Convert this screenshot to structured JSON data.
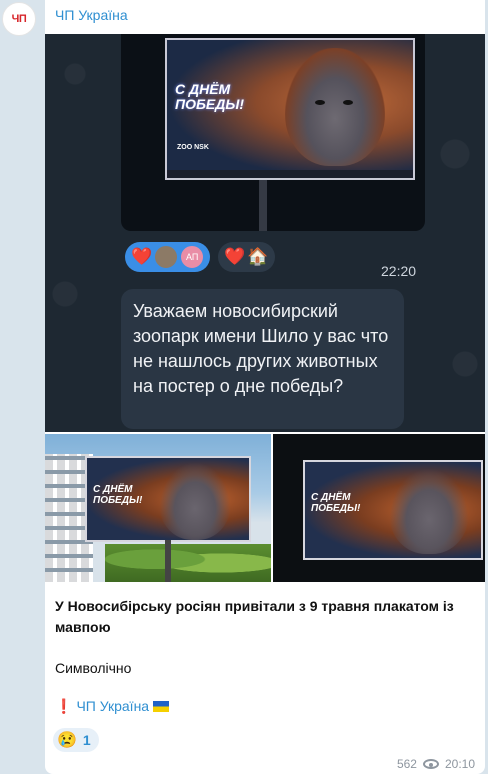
{
  "channel": {
    "avatar_text": "ЧП",
    "name": "ЧП Україна"
  },
  "screenshot": {
    "billboard_text": "С ДНЁМ ПОБЕДЫ!",
    "billboard_logo": "ZOO NSK",
    "reactions": [
      "❤️",
      "❤️",
      "🏠"
    ],
    "reaction_avatar_text": "АП",
    "time": "22:20",
    "message": "Уважаем новосибирский зоопарк имени Шило у вас что не нашлось других животных на постер о дне победы?"
  },
  "photos": {
    "left_billboard_text": "С ДНЁМ ПОБЕДЫ!",
    "right_billboard_text": "С ДНЁМ ПОБЕДЫ!"
  },
  "post": {
    "title": "У Новосибірську росіян привітали з 9 травня плакатом із мавпою",
    "body": "Символічно",
    "signature_mark": "❗",
    "signature": "ЧП Україна",
    "reaction_emoji": "😢",
    "reaction_count": "1",
    "views": "562",
    "time": "20:10"
  },
  "colors": {
    "accent": "#2f8fd1",
    "brand_red": "#d7262b",
    "chat_background": "#d9e4ec"
  }
}
